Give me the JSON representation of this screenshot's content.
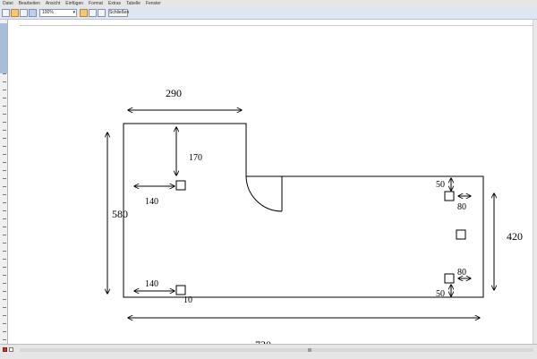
{
  "menu": {
    "items": [
      "Datei",
      "Bearbeiten",
      "Ansicht",
      "Einfügen",
      "Format",
      "Extras",
      "Tabelle",
      "Fenster"
    ]
  },
  "toolbar": {
    "zoom": "100%",
    "close_label": "Schließen"
  },
  "diagram": {
    "dimensions": {
      "top_width": "290",
      "left_height": "580",
      "bottom_width": "730",
      "right_height": "420",
      "inner_vertical": "170",
      "socket_offset_upper": "140",
      "socket_offset_lower": "140",
      "lower_socket_gap": "10",
      "right_top_gap": "50",
      "right_top_side": "80",
      "right_bottom_side": "80",
      "right_bottom_gap": "50"
    }
  },
  "colors": {
    "line": "#000000",
    "menubar": "#e6e6e6",
    "toolbar": "#dfe6f2",
    "ruler_highlight": "#a9bddb",
    "active_view": "#c43b2a"
  }
}
